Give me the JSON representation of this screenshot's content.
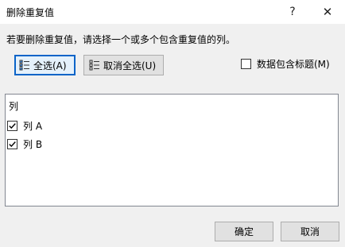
{
  "window": {
    "title": "删除重复值",
    "help_glyph": "?",
    "close_glyph": "✕"
  },
  "instruction": "若要删除重复值，请选择一个或多个包含重复值的列。",
  "select_all": {
    "label": "全选(A)"
  },
  "unselect_all": {
    "label": "取消全选(U)"
  },
  "header_option": {
    "label": "数据包含标题(M)",
    "checked": false
  },
  "list": {
    "header": "列",
    "items": [
      {
        "label": "列 A",
        "checked": true
      },
      {
        "label": "列 B",
        "checked": true
      }
    ]
  },
  "buttons": {
    "ok": "确定",
    "cancel": "取消"
  },
  "colors": {
    "accent": "#0a64c8",
    "dialog_bg": "#f0f0f0",
    "list_bg": "#ffffff"
  }
}
